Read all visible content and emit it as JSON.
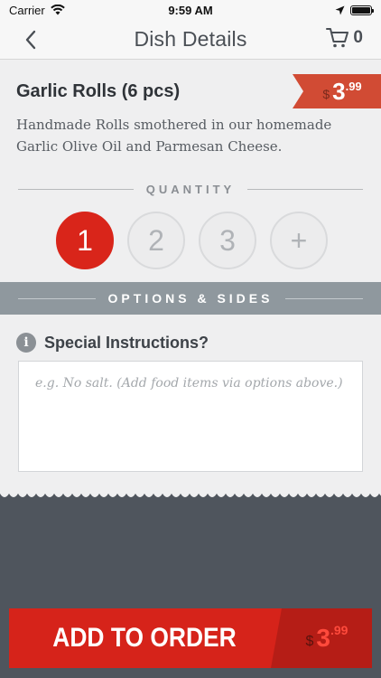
{
  "status_bar": {
    "carrier": "Carrier",
    "time": "9:59 AM",
    "battery_level": 1.0
  },
  "nav": {
    "title": "Dish Details",
    "cart_count": "0"
  },
  "dish": {
    "name": "Garlic Rolls (6 pcs)",
    "price_symbol": "$",
    "price_int": "3",
    "price_cents": ".99",
    "description": "Handmade Rolls smothered in our homemade Garlic Olive Oil and Parmesan Cheese."
  },
  "quantity": {
    "label": "QUANTITY",
    "options": [
      "1",
      "2",
      "3",
      "+"
    ],
    "selected": "1"
  },
  "options_sides": {
    "label": "OPTIONS & SIDES"
  },
  "special": {
    "label": "Special Instructions?",
    "info_glyph": "i",
    "placeholder": "e.g. No salt. (Add food items via options above.)"
  },
  "order_button": {
    "label": "ADD TO ORDER",
    "price_symbol": "$",
    "price_int": "3",
    "price_cents": ".99"
  },
  "colors": {
    "accent_red": "#d6231a",
    "price_tag": "#d14b34",
    "options_bar": "#8f989e",
    "footer_bg": "#4f555d"
  }
}
